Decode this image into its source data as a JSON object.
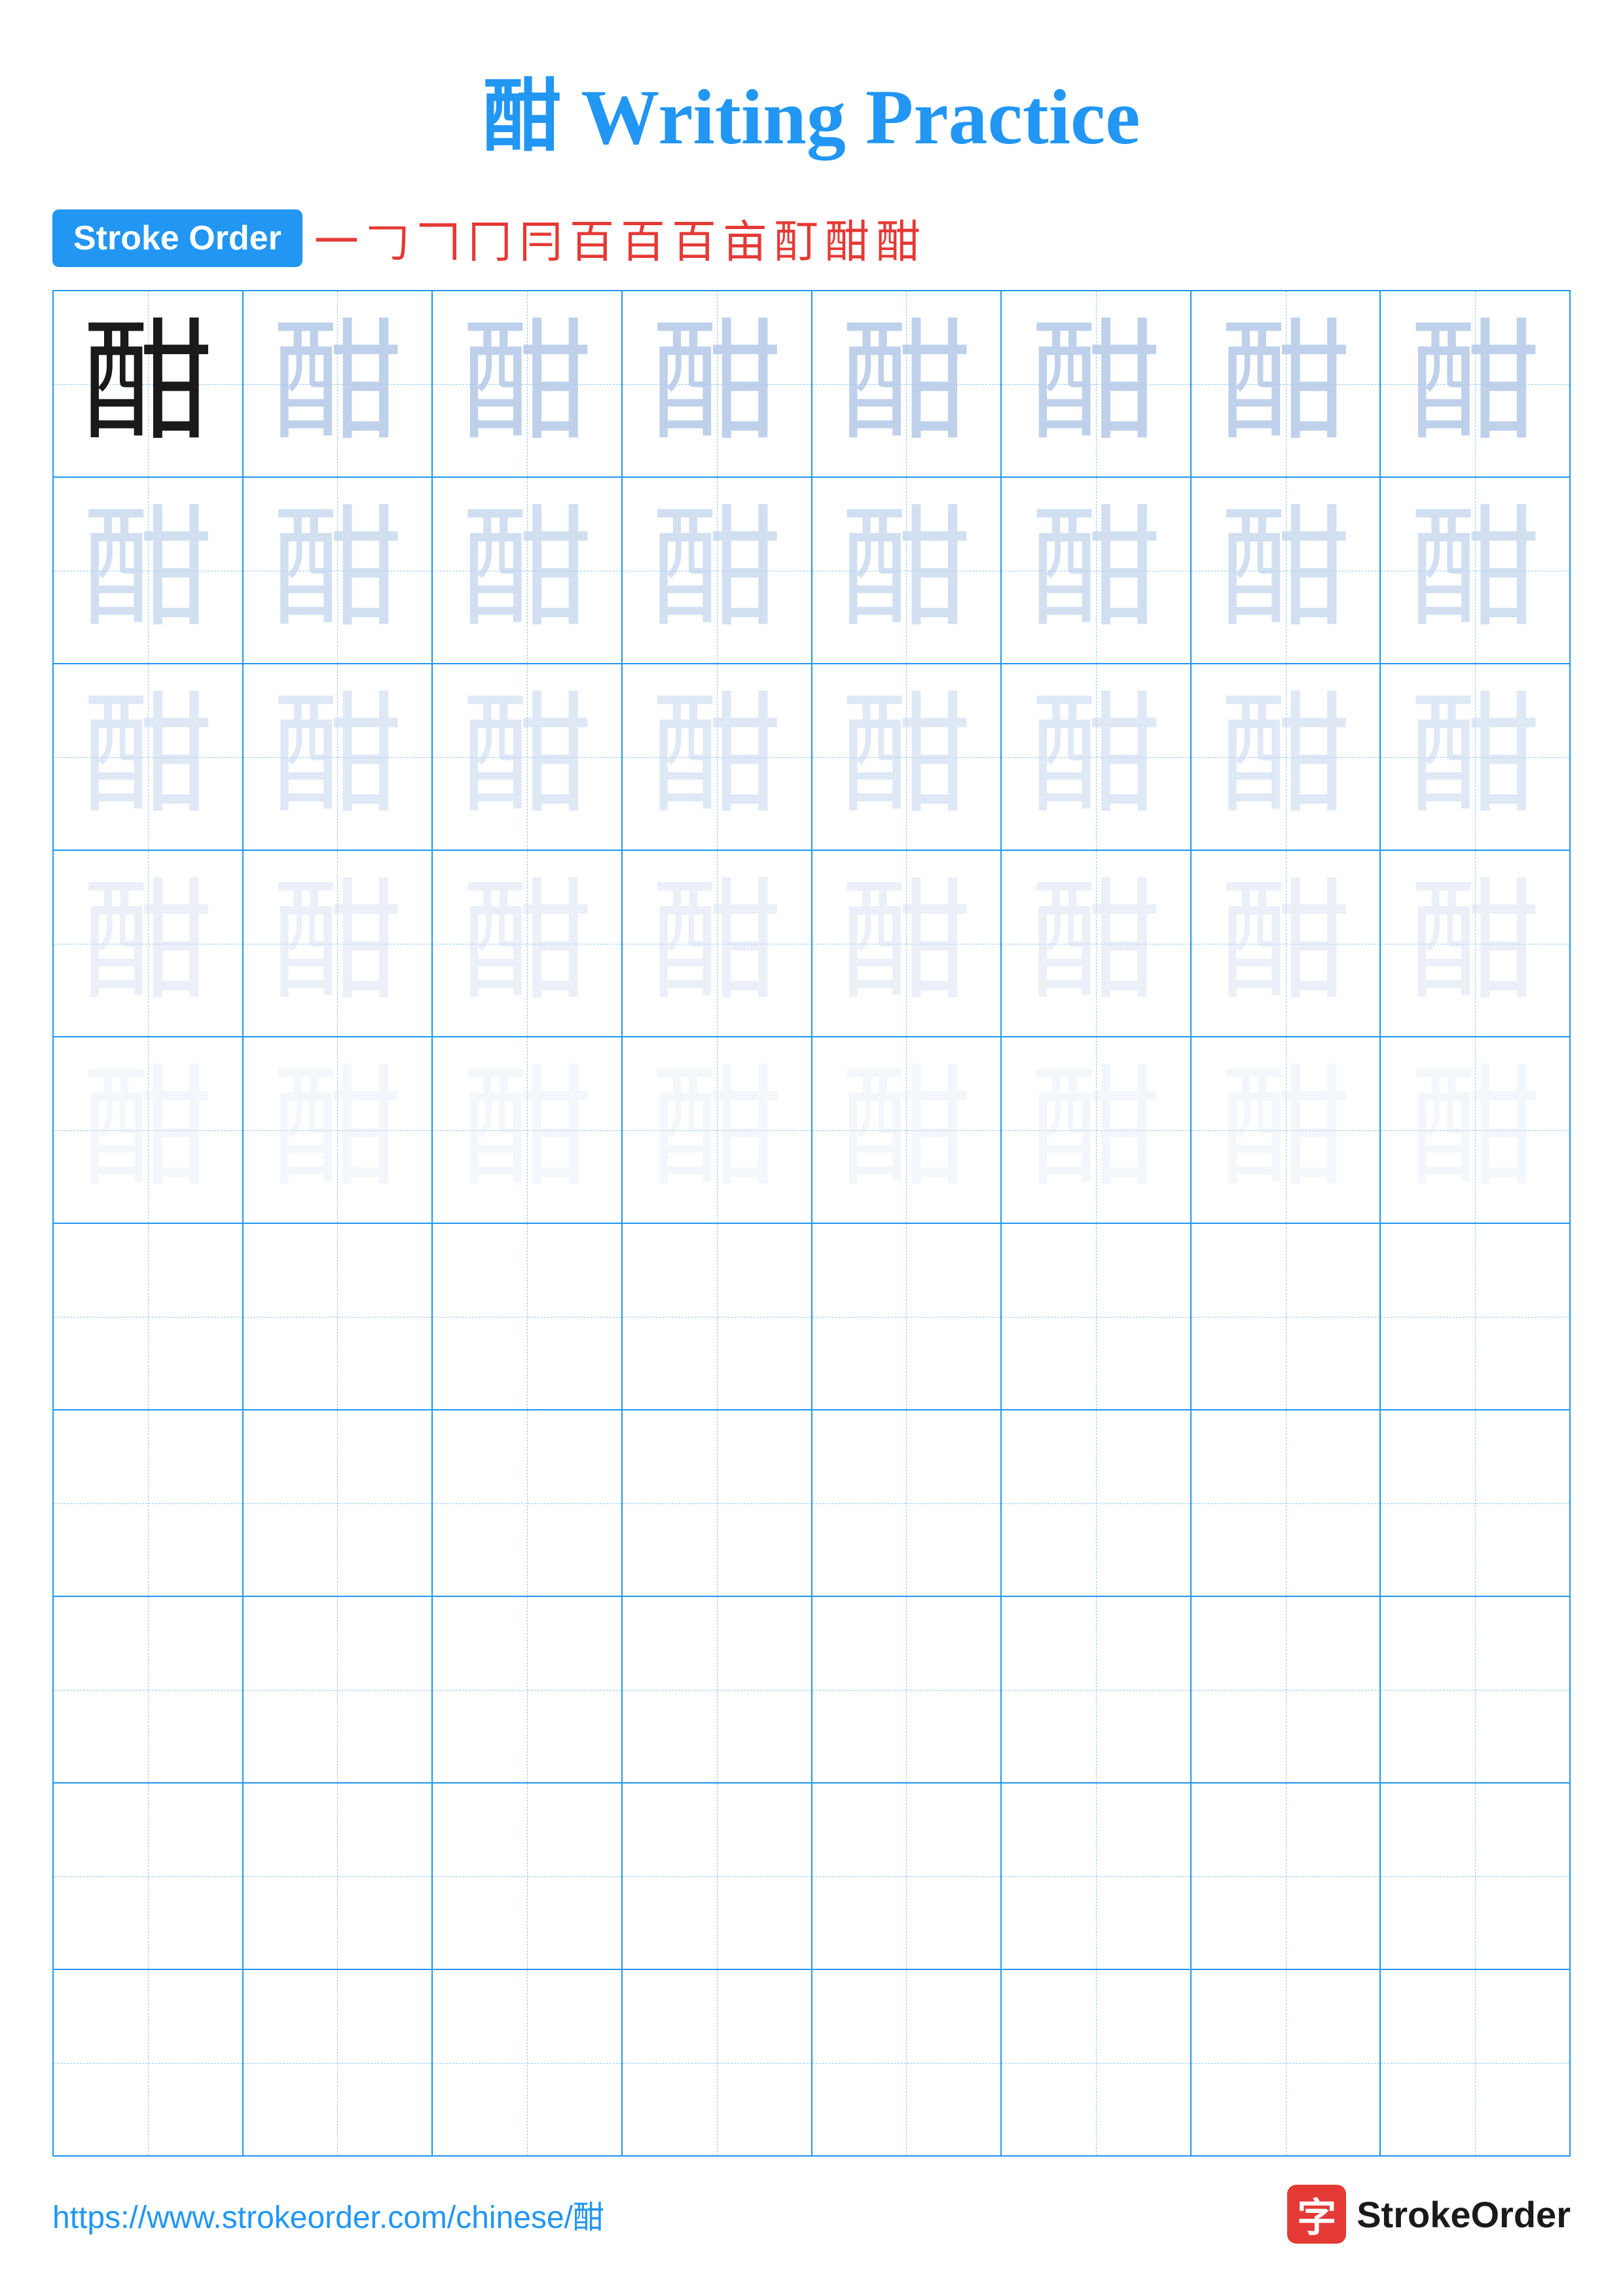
{
  "title": "酣 Writing Practice",
  "character": "酣",
  "stroke_order_label": "Stroke Order",
  "stroke_order_chars": [
    "一",
    "𠃌",
    "𠃍",
    "冂",
    "冃",
    "百",
    "百̄",
    "百𠃌",
    "亩",
    "酊",
    "酣",
    "酣"
  ],
  "stroke_display": [
    "㇐",
    "𠃌",
    "𠃍",
    "冂",
    "冃",
    "百",
    "百",
    "百",
    "亩",
    "酊",
    "酣",
    "酣"
  ],
  "rows": [
    {
      "type": "solid+light1",
      "count": 8
    },
    {
      "type": "light2",
      "count": 8
    },
    {
      "type": "light3",
      "count": 8
    },
    {
      "type": "light4",
      "count": 8
    },
    {
      "type": "light5",
      "count": 8
    },
    {
      "type": "empty",
      "count": 8
    },
    {
      "type": "empty",
      "count": 8
    },
    {
      "type": "empty",
      "count": 8
    },
    {
      "type": "empty",
      "count": 8
    },
    {
      "type": "empty",
      "count": 8
    }
  ],
  "footer_url": "https://www.strokeorder.com/chinese/酣",
  "footer_brand_char": "字",
  "footer_brand_name": "StrokeOrder"
}
